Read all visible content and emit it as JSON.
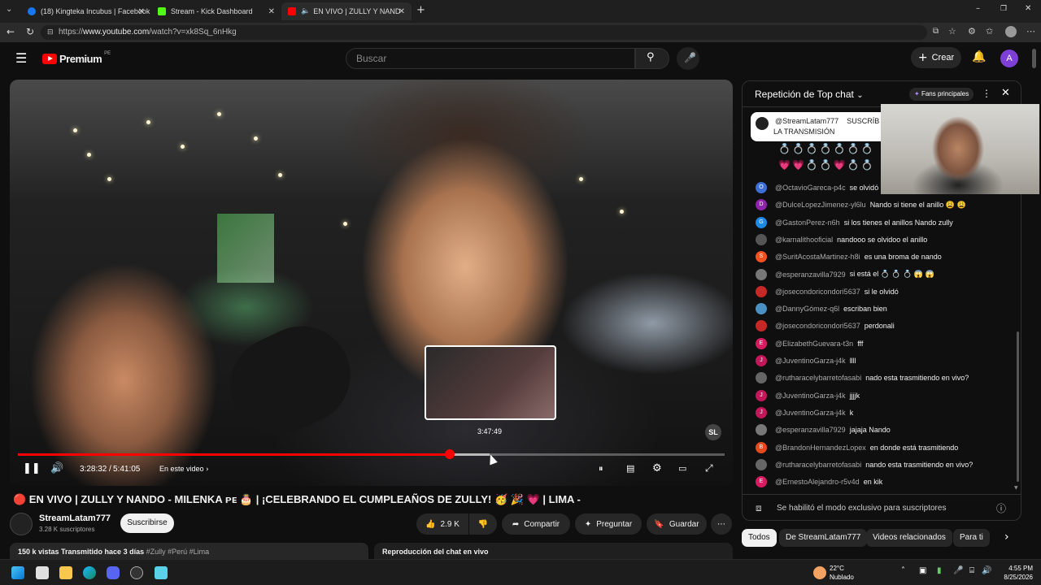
{
  "browser": {
    "tabs": [
      {
        "label": "(18) Kingteka Incubus | Facebook",
        "color": "#1877f2"
      },
      {
        "label": "Stream - Kick Dashboard",
        "color": "#53fc18"
      },
      {
        "label": "EN VIVO | ZULLY Y NAND",
        "color": "#ff0000"
      }
    ],
    "url_prefix": "https://",
    "url_host": "www.youtube.com",
    "url_path": "/watch?v=xk8Sq_6nHkg"
  },
  "header": {
    "logo": "Premium",
    "logo_region": "PE",
    "search_placeholder": "Buscar",
    "create_label": "Crear",
    "avatar_letter": "A"
  },
  "player": {
    "preview_time": "3:47:49",
    "current_time": "3:28:32",
    "duration": "5:41:05",
    "in_video_label": "En este video",
    "progress_fraction": 0.611,
    "buffer_fraction": 0.668,
    "watermark": "SL"
  },
  "video": {
    "title": "🔴 EN VIVO | ZULLY Y NANDO - MILENKA ᴘᴇ 🎂 | ¡CELEBRANDO EL CUMPLEAÑOS DE ZULLY! 🥳 🎉 💗 | LIMA -",
    "channel": "StreamLatam777",
    "subscribers": "3.28 K suscriptores",
    "subscribe_label": "Suscribirse",
    "likes": "2.9 K",
    "share_label": "Compartir",
    "ask_label": "Preguntar",
    "save_label": "Guardar",
    "desc_stats": "150 k vistas  Transmitido hace 3 días",
    "desc_tags": "#Zully #Perú #Lima",
    "chat_replay_label": "Reproducción del chat en vivo"
  },
  "chat": {
    "title": "Repetición de Top chat",
    "fans_label": "Fans principales",
    "pinned_author": "@StreamLatam777",
    "pinned_text": "SUSCRÍB",
    "pinned_text2": "LA TRANSMISIÓN",
    "emoji_row1": "💍💍💍💍💍💍💍",
    "emoji_row2": "💗💗💍💍💗💍💍",
    "messages": [
      {
        "avatar": "O",
        "color": "#3b6fd6",
        "author": "@OctavioGareca-p4c",
        "text": "se olvidó"
      },
      {
        "avatar": "D",
        "color": "#8e24aa",
        "author": "@DulceLopezJimenez-yl6lu",
        "text": "Nando si tiene el anillo 😩 😩"
      },
      {
        "avatar": "G",
        "color": "#1e88e5",
        "author": "@GastonPerez-n6h",
        "text": "si los tienes el anillos Nando zully"
      },
      {
        "avatar": "",
        "color": "#555555",
        "author": "@karnalithooficial",
        "text": "nandooo se olvidoo el anillo"
      },
      {
        "avatar": "S",
        "color": "#f4511e",
        "author": "@SuritAcostaMartinez-h8i",
        "text": "es una broma de nando"
      },
      {
        "avatar": "",
        "color": "#777777",
        "author": "@esperanzavilla7929",
        "text": "si está el 💍 💍 💍 😱 😱"
      },
      {
        "avatar": "",
        "color": "#c62828",
        "author": "@josecondoricondori5637",
        "text": "si le olvidó"
      },
      {
        "avatar": "",
        "color": "#4a90c2",
        "author": "@DannyGómez-q6l",
        "text": "escriban bien"
      },
      {
        "avatar": "",
        "color": "#c62828",
        "author": "@josecondoricondori5637",
        "text": "perdonali"
      },
      {
        "avatar": "E",
        "color": "#d81b60",
        "author": "@ElizabethGuevara-t3n",
        "text": "fff"
      },
      {
        "avatar": "J",
        "color": "#c2185b",
        "author": "@JuventinoGarza-j4k",
        "text": "llll"
      },
      {
        "avatar": "",
        "color": "#666666",
        "author": "@rutharacelybarretofasabi",
        "text": "nado esta trasmitiendo en vivo?"
      },
      {
        "avatar": "J",
        "color": "#c2185b",
        "author": "@JuventinoGarza-j4k",
        "text": "jjjjk"
      },
      {
        "avatar": "J",
        "color": "#c2185b",
        "author": "@JuventinoGarza-j4k",
        "text": "k"
      },
      {
        "avatar": "",
        "color": "#777777",
        "author": "@esperanzavilla7929",
        "text": "jajaja Nando"
      },
      {
        "avatar": "B",
        "color": "#e64a19",
        "author": "@BrandonHernandezLopex",
        "text": "en donde está trasmitiendo"
      },
      {
        "avatar": "",
        "color": "#666666",
        "author": "@rutharacelybarretofasabi",
        "text": "nando esta trasmitiendo en vivo?"
      },
      {
        "avatar": "E",
        "color": "#d81b60",
        "author": "@ErnestoAlejandro-r5v4d",
        "text": "en kik"
      }
    ],
    "footer": "Se habilitó el modo exclusivo para suscriptores"
  },
  "chips": [
    "Todos",
    "De StreamLatam777",
    "Videos relacionados",
    "Para ti"
  ],
  "taskbar": {
    "temperature": "22°C",
    "weather": "Nublado",
    "time": "4:55 PM",
    "date": "8/25/2026"
  }
}
